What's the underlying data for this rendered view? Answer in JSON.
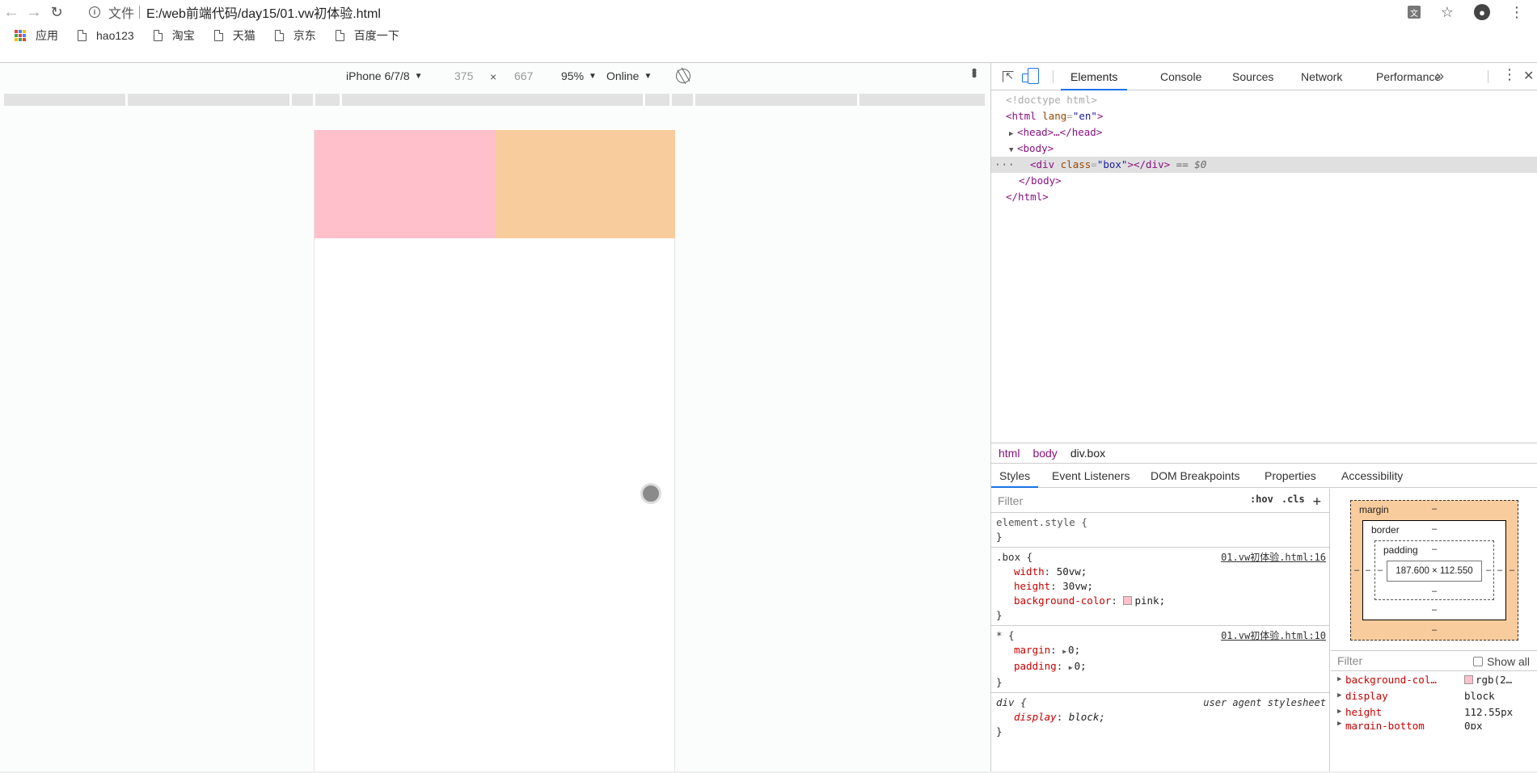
{
  "browser": {
    "scheme_label": "文件",
    "url": "E:/web前端代码/day15/01.vw初体验.html",
    "bookmarks": [
      "应用",
      "hao123",
      "淘宝",
      "天猫",
      "京东",
      "百度一下"
    ]
  },
  "device_toolbar": {
    "device": "iPhone 6/7/8",
    "width": "375",
    "times": "×",
    "height": "667",
    "zoom": "95%",
    "network": "Online"
  },
  "devtools": {
    "tabs": [
      "Elements",
      "Console",
      "Sources",
      "Network",
      "Performance"
    ],
    "more": "»",
    "dom": {
      "doctype": "<!doctype html>",
      "html_open_tag": "html",
      "html_attr": "lang",
      "html_attr_val": "\"en\"",
      "head_text": "<head>…</head>",
      "body_open": "<body>",
      "div_tag": "div",
      "div_attr": "class",
      "div_attr_val": "\"box\"",
      "div_close": "></div>",
      "selected_marker": "== $0",
      "body_close": "</body>",
      "html_close": "</html>"
    },
    "breadcrumb": [
      "html",
      "body",
      "div.box"
    ],
    "sub_tabs": [
      "Styles",
      "Event Listeners",
      "DOM Breakpoints",
      "Properties",
      "Accessibility"
    ],
    "styles": {
      "filter_placeholder": "Filter",
      "hov": ":hov",
      "cls": ".cls",
      "plus": "+",
      "element_style": "element.style {",
      "close_brace": "}",
      "box_rule": {
        "selector": ".box {",
        "source": "01.vw初体验.html:16",
        "decls": [
          {
            "name": "width",
            "value": "50vw;"
          },
          {
            "name": "height",
            "value": "30vw;"
          },
          {
            "name": "background-color",
            "value": "pink;"
          }
        ]
      },
      "star_rule": {
        "selector": "* {",
        "source": "01.vw初体验.html:10",
        "decls": [
          {
            "name": "margin",
            "value": "0;"
          },
          {
            "name": "padding",
            "value": "0;"
          }
        ]
      },
      "ua_rule": {
        "selector": "div {",
        "source": "user agent stylesheet",
        "decls": [
          {
            "name": "display",
            "value": "block;"
          }
        ]
      }
    },
    "box_model": {
      "margin_label": "margin",
      "border_label": "border",
      "padding_label": "padding",
      "dash": "–",
      "content_size": "187.600 × 112.550"
    },
    "computed": {
      "filter_placeholder": "Filter",
      "show_all": "Show all",
      "rows": [
        {
          "name": "background-col…",
          "value": "rgb(2…"
        },
        {
          "name": "display",
          "value": "block"
        },
        {
          "name": "height",
          "value": "112.55px"
        },
        {
          "name": "margin-bottom",
          "value": "0px"
        }
      ]
    }
  },
  "colors": {
    "pink": "#ffc0cb",
    "margin_overlay": "#f9cc9d",
    "active_tab": "#1a73e8"
  }
}
